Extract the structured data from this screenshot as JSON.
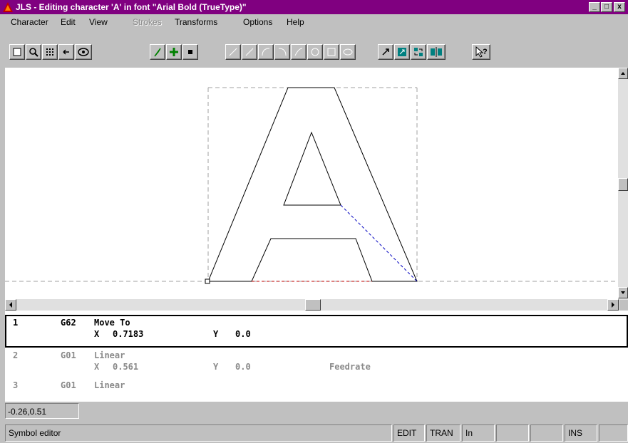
{
  "window": {
    "title": "JLS - Editing character 'A' in font \"Arial Bold (TrueType)\"",
    "controls": [
      "_",
      "□",
      "x"
    ]
  },
  "menu": {
    "items": [
      {
        "label": "Character",
        "enabled": true
      },
      {
        "label": "Edit",
        "enabled": true
      },
      {
        "label": "View",
        "enabled": true
      },
      {
        "label": "Strokes",
        "enabled": false
      },
      {
        "label": "Transforms",
        "enabled": true
      },
      {
        "label": "Options",
        "enabled": true
      },
      {
        "label": "Help",
        "enabled": true
      }
    ]
  },
  "toolbar": {
    "icons": [
      "select-box-icon",
      "zoom-icon",
      "grid-icon",
      "fit-icon",
      "view-icon",
      "pointer-arrow-icon",
      "add-point-icon",
      "point-icon",
      "line-icon",
      "line2-icon",
      "arc-icon",
      "arc2-icon",
      "curve-icon",
      "circle-icon",
      "rect-icon",
      "ellipse-icon",
      "scale-icon",
      "resize-icon",
      "mirror-icon",
      "align-icon",
      "help-pointer-icon"
    ],
    "colors": {
      "green": "#008000",
      "yellow": "#c8c800",
      "cyan": "#008080"
    }
  },
  "canvas": {
    "glyph": "A",
    "colors": {
      "outline": "#000000",
      "bounds": "#a0a0a0",
      "path_blue": "#0000c0",
      "path_red": "#c00000"
    }
  },
  "codelist": {
    "rows": [
      {
        "num": "1",
        "code": "G62",
        "name": "Move To",
        "x_label": "X",
        "x_value": "0.7183",
        "y_label": "Y",
        "y_value": "0.0",
        "extra": "",
        "selected": true
      },
      {
        "num": "2",
        "code": "G01",
        "name": "Linear",
        "x_label": "X",
        "x_value": "0.561",
        "y_label": "Y",
        "y_value": "0.0",
        "extra": "Feedrate",
        "selected": false
      },
      {
        "num": "3",
        "code": "G01",
        "name": "Linear",
        "x_label": "",
        "x_value": "",
        "y_label": "",
        "y_value": "",
        "extra": "",
        "selected": false
      }
    ]
  },
  "coords": "-0.26,0.51",
  "status": {
    "message": "Symbol editor",
    "panels": [
      "EDIT",
      "TRAN",
      "In",
      "",
      "",
      "INS",
      ""
    ]
  }
}
